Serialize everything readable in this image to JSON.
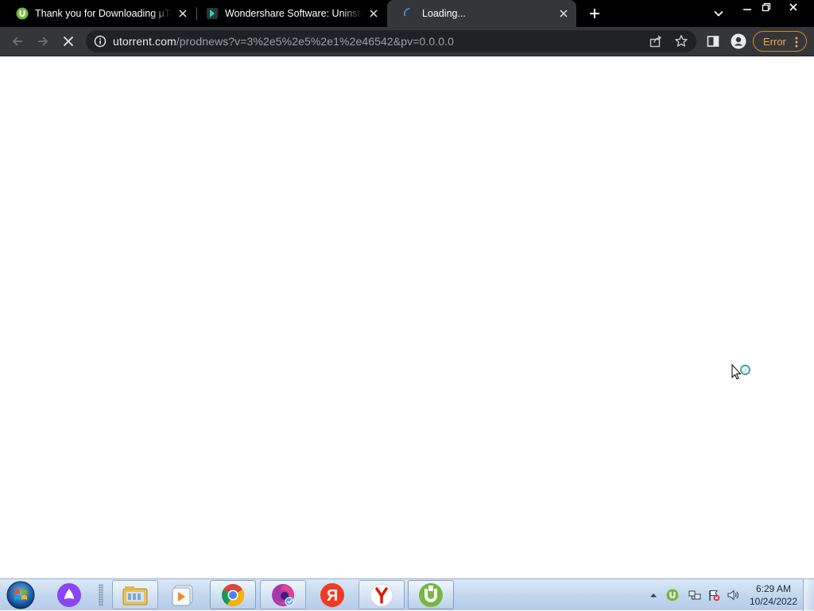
{
  "browser": {
    "tabs": [
      {
        "title": "Thank you for Downloading µTorrent",
        "favicon": "utorrent-icon",
        "active": false
      },
      {
        "title": "Wondershare Software: Uninstall",
        "favicon": "wondershare-icon",
        "active": false
      },
      {
        "title": "Loading...",
        "favicon": "loading-spinner-icon",
        "active": true
      }
    ],
    "new_tab_icon": "plus-icon",
    "address_bar": {
      "host": "utorrent.com",
      "path": "/prodnews?v=3%2e5%2e5%2e1%2e46542&pv=0.0.0.0"
    },
    "profile_chip": {
      "label": "Error"
    },
    "colors": {
      "tab_strip": "#000000",
      "toolbar": "#35363a",
      "omnibox": "#202124",
      "error_chip": "#f2a93b"
    }
  },
  "taskbar": {
    "apps": [
      {
        "name": "alice-assistant-icon"
      },
      {
        "name": "windows-explorer-icon"
      },
      {
        "name": "media-player-icon"
      },
      {
        "name": "chrome-icon"
      },
      {
        "name": "firefox-icon"
      },
      {
        "name": "yandex-icon"
      },
      {
        "name": "yandex-browser-icon"
      },
      {
        "name": "utorrent-icon"
      }
    ],
    "tray": [
      {
        "name": "chevron-up-icon"
      },
      {
        "name": "utorrent-tray-icon"
      },
      {
        "name": "network-icon"
      },
      {
        "name": "flag-error-icon"
      },
      {
        "name": "volume-icon"
      }
    ],
    "clock": {
      "time": "6:29 AM",
      "date": "10/24/2022"
    }
  }
}
